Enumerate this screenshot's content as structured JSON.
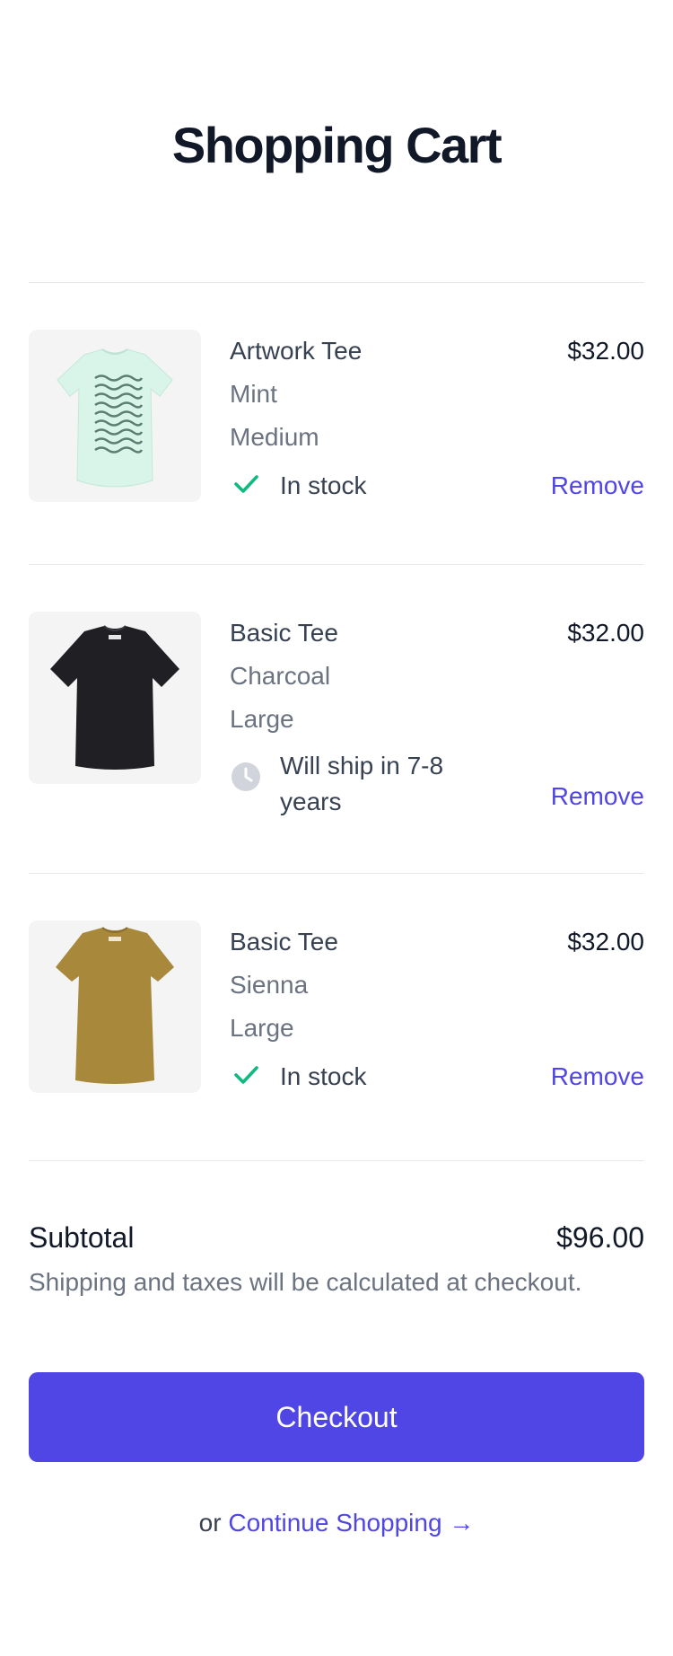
{
  "page": {
    "title": "Shopping Cart"
  },
  "cart": {
    "remove_label": "Remove",
    "items": [
      {
        "name": "Artwork Tee",
        "price": "$32.00",
        "color": "Mint",
        "size": "Medium",
        "status_icon": "check-icon",
        "status": "In stock"
      },
      {
        "name": "Basic Tee",
        "price": "$32.00",
        "color": "Charcoal",
        "size": "Large",
        "status_icon": "clock-icon",
        "status_line1": "Will ship in 7-8",
        "status_line2": "years"
      },
      {
        "name": "Basic Tee",
        "price": "$32.00",
        "color": "Sienna",
        "size": "Large",
        "status_icon": "check-icon",
        "status": "In stock"
      }
    ]
  },
  "summary": {
    "subtotal_label": "Subtotal",
    "subtotal_value": "$96.00",
    "note": "Shipping and taxes will be calculated at checkout.",
    "checkout_label": "Checkout",
    "or_text": "or",
    "continue_label": "Continue Shopping →"
  },
  "colors": {
    "accent": "#4f46e5",
    "in_stock": "#10b981",
    "clock": "#d1d5db",
    "tee_mint": "#d9f5ea",
    "tee_charcoal": "#1f1f24",
    "tee_sienna": "#a8883a"
  }
}
